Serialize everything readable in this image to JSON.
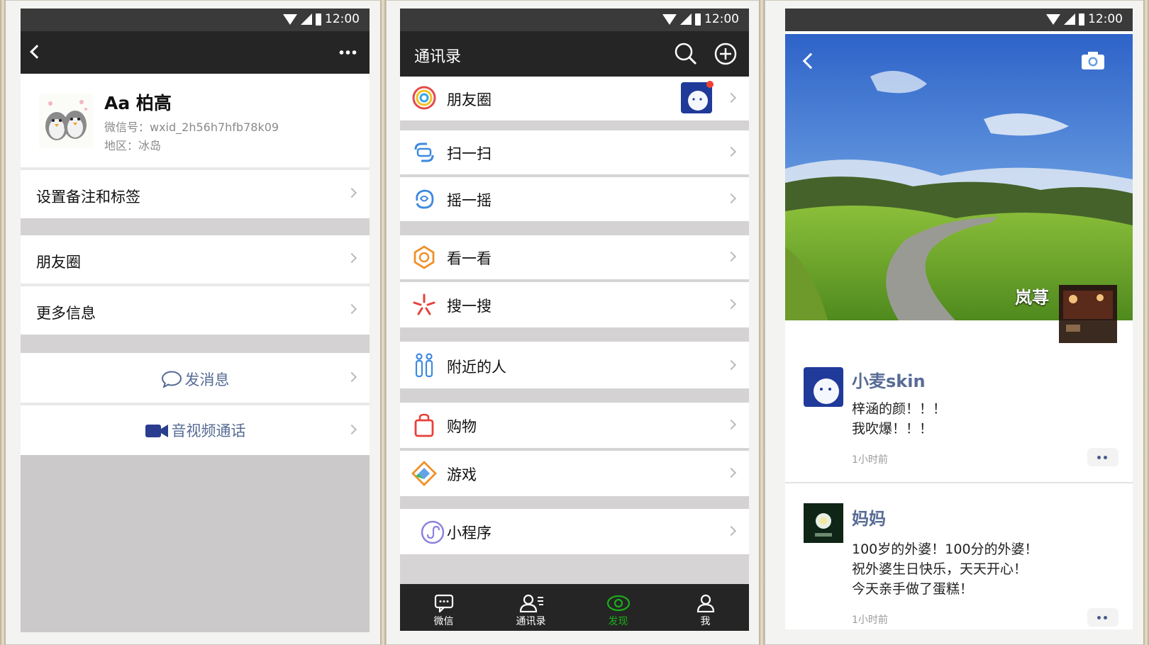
{
  "status": {
    "time": "12:00"
  },
  "profile": {
    "name": "Aa 柏高",
    "wechat_id": "微信号：wxid_2h56h7hfb78k09",
    "region": "地区：冰岛",
    "items": [
      "设置备注和标签",
      "朋友圈",
      "更多信息"
    ],
    "send_message": "发消息",
    "video_call": "音视频通话"
  },
  "discover": {
    "title": "通讯录",
    "items": [
      "朋友圈",
      "扫一扫",
      "摇一摇",
      "看一看",
      "搜一搜",
      "附近的人",
      "购物",
      "游戏",
      "小程序"
    ],
    "tabs": [
      "微信",
      "通讯录",
      "发现",
      "我"
    ]
  },
  "moments": {
    "owner_name": "岚荨",
    "posts": [
      {
        "author": "小麦skin",
        "lines": [
          "梓涵的颜！！！",
          "我吹爆！！！"
        ],
        "time": "1小时前"
      },
      {
        "author": "妈妈",
        "lines": [
          "100岁的外婆！100分的外婆！",
          "祝外婆生日快乐，天天开心！",
          "今天亲手做了蛋糕！"
        ],
        "time": "1小时前"
      }
    ]
  },
  "colors": {
    "accent_green": "#1aad19",
    "link_blue": "#576b95",
    "nav_dark": "#252525"
  }
}
